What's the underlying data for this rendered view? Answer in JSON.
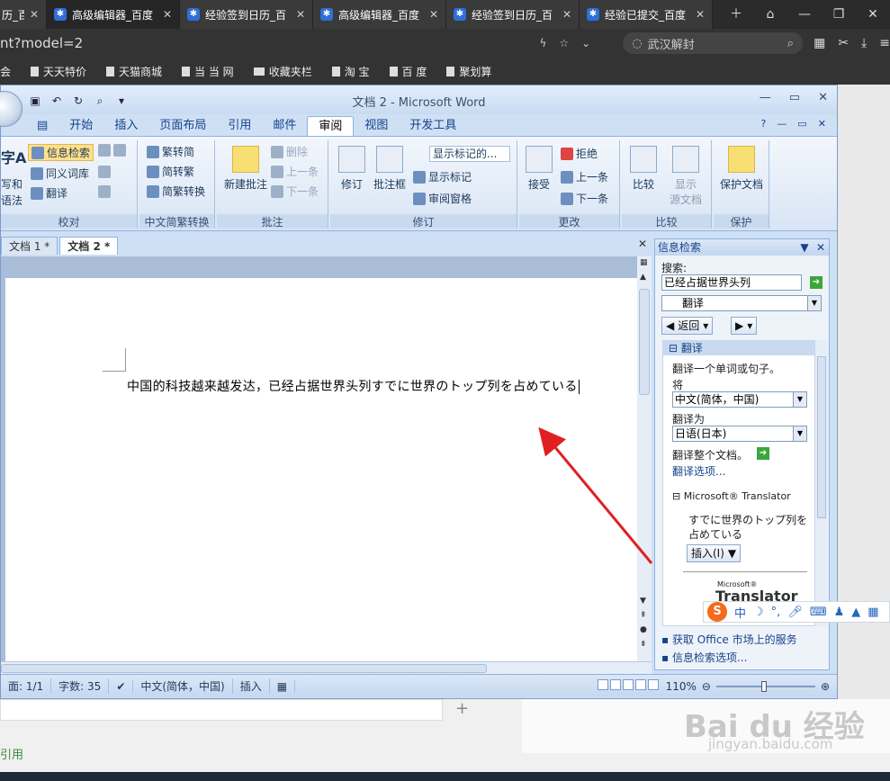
{
  "browser": {
    "tabs": [
      {
        "label": "历_百",
        "active": false
      },
      {
        "label": "高级编辑器_百度",
        "active": true
      },
      {
        "label": "经验签到日历_百",
        "active": false
      },
      {
        "label": "高级编辑器_百度",
        "active": false
      },
      {
        "label": "经验签到日历_百",
        "active": false
      },
      {
        "label": "经验已提交_百度",
        "active": false
      }
    ],
    "address": "nt?model=2",
    "search_placeholder": "武汉解封",
    "bookmarks": [
      "会",
      "天天特价",
      "天猫商城",
      "当 当 网",
      "收藏夹栏",
      "淘 宝",
      "百 度",
      "聚划算"
    ]
  },
  "word": {
    "title": "文档 2 - Microsoft Word",
    "menu_tabs": [
      "开始",
      "插入",
      "页面布局",
      "引用",
      "邮件",
      "审阅",
      "视图",
      "开发工具"
    ],
    "active_menu": "审阅",
    "ribbon": {
      "proofing": {
        "label": "校对",
        "spell_a": "字A",
        "spell_b": "写和",
        "spell_c": "语法",
        "research": "信息检索",
        "thesaurus": "同义词库",
        "translate": "翻译"
      },
      "chinese": {
        "label": "中文简繁转换",
        "t2s": "繁转简",
        "s2t": "简转繁",
        "convert": "简繁转换"
      },
      "comments": {
        "label": "批注",
        "new": "新建批注",
        "delete": "删除",
        "prev": "上一条",
        "next": "下一条"
      },
      "tracking": {
        "label": "修订",
        "track": "修订",
        "balloons": "批注框",
        "display_combo": "显示标记的...",
        "show_markup": "显示标记",
        "review_pane": "审阅窗格"
      },
      "changes": {
        "label": "更改",
        "accept": "接受",
        "reject": "拒绝",
        "prev": "上一条",
        "next": "下一条"
      },
      "compare": {
        "label": "比较",
        "compare": "比较",
        "show_source": "显示",
        "show_source2": "源文档"
      },
      "protect": {
        "label": "保护",
        "protect": "保护文档"
      }
    },
    "doc_tabs": [
      "文档 1 *",
      "文档 2 *"
    ],
    "document_text": "中国的科技越来越发达，已经占据世界头列すでに世界のトップ列を占めている",
    "research_pane": {
      "title": "信息检索",
      "search_label": "搜索:",
      "search_value": "已经占据世界头列",
      "service": "翻译",
      "back": "返回",
      "section": "翻译",
      "hint": "翻译一个单词或句子。",
      "from_label": "将",
      "from_value": "中文(简体，中国)",
      "to_label": "翻译为",
      "to_value": "日语(日本)",
      "translate_doc": "翻译整个文档。",
      "options": "翻译选项...",
      "translator_title": "Microsoft® Translator",
      "result_line1": "すでに世界のトップ列を",
      "result_line2": "占めている",
      "insert": "插入(I)",
      "logo_small": "Microsoft®",
      "logo": "Translator",
      "get_services": "获取 Office 市场上的服务",
      "research_options": "信息检索选项..."
    },
    "status": {
      "page": "面: 1/1",
      "words": "字数: 35",
      "language": "中文(简体，中国)",
      "mode": "插入",
      "zoom": "110%"
    }
  },
  "overlay": {
    "ime": "中",
    "watermark": "Bai du 经验",
    "watermark_url": "jingyan.baidu.com",
    "below_label": "引用"
  }
}
